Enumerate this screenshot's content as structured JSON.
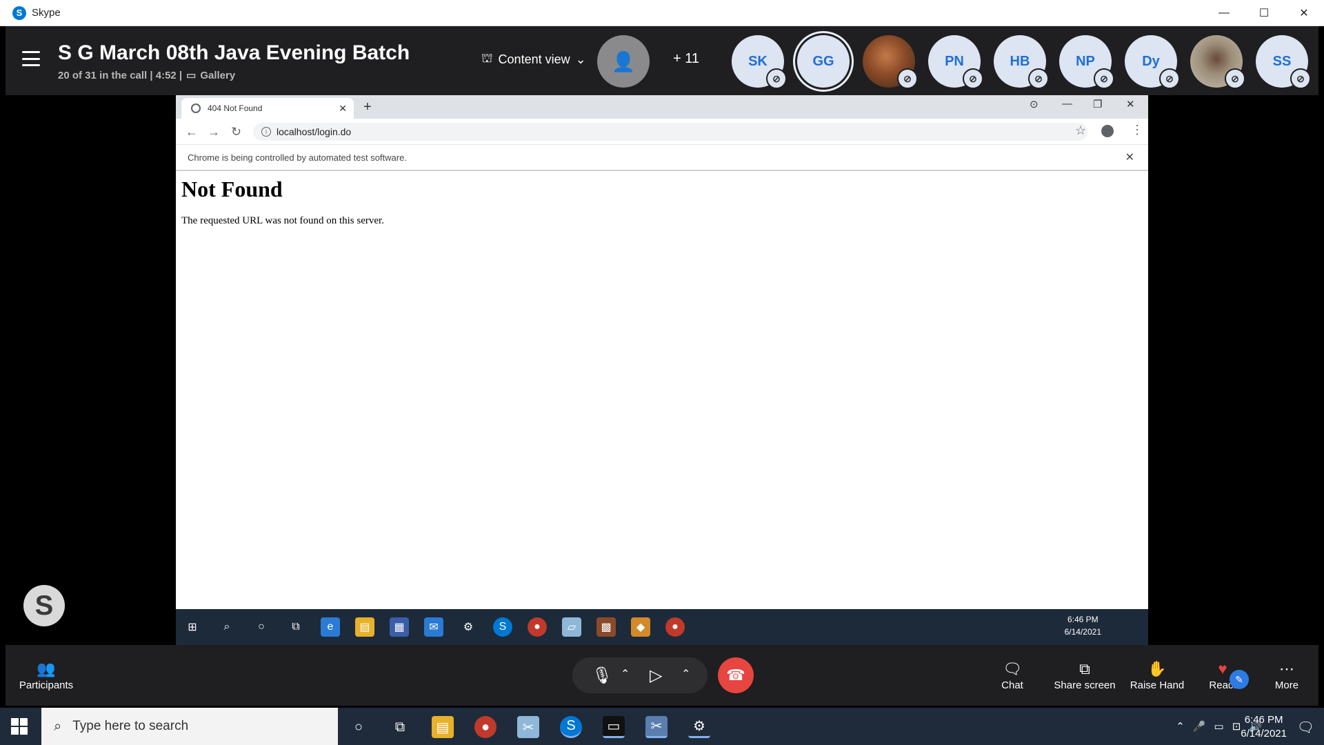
{
  "window": {
    "app_name": "Skype",
    "minimize": "—",
    "maximize": "☐",
    "close": "✕"
  },
  "call": {
    "title": "S G March 08th Java Evening Batch",
    "status": "20 of 31 in the call | 4:52 |",
    "view_mode": "Gallery",
    "content_view": "Content view",
    "more_count": "11",
    "participants": [
      {
        "initials": "SK",
        "muted": true
      },
      {
        "initials": "GG",
        "muted": false,
        "active": true
      },
      {
        "initials": "",
        "muted": true,
        "photo": true
      },
      {
        "initials": "PN",
        "muted": true
      },
      {
        "initials": "HB",
        "muted": true
      },
      {
        "initials": "NP",
        "muted": true
      },
      {
        "initials": "Dy",
        "muted": true
      },
      {
        "initials": "",
        "muted": true,
        "photo": true
      },
      {
        "initials": "SS",
        "muted": true
      }
    ]
  },
  "browser": {
    "tab_title": "404 Not Found",
    "url": "localhost/login.do",
    "infobar": "Chrome is being controlled by automated test software.",
    "page_heading": "Not Found",
    "page_text": "The requested URL was not found on this server.",
    "taskbar_time": "6:46 PM",
    "taskbar_date": "6/14/2021"
  },
  "controls": {
    "participants": "Participants",
    "chat": "Chat",
    "share_screen": "Share screen",
    "raise_hand": "Raise Hand",
    "react": "React",
    "more": "More"
  },
  "taskbar": {
    "search_placeholder": "Type here to search",
    "time": "6:46 PM",
    "date": "6/14/2021"
  }
}
